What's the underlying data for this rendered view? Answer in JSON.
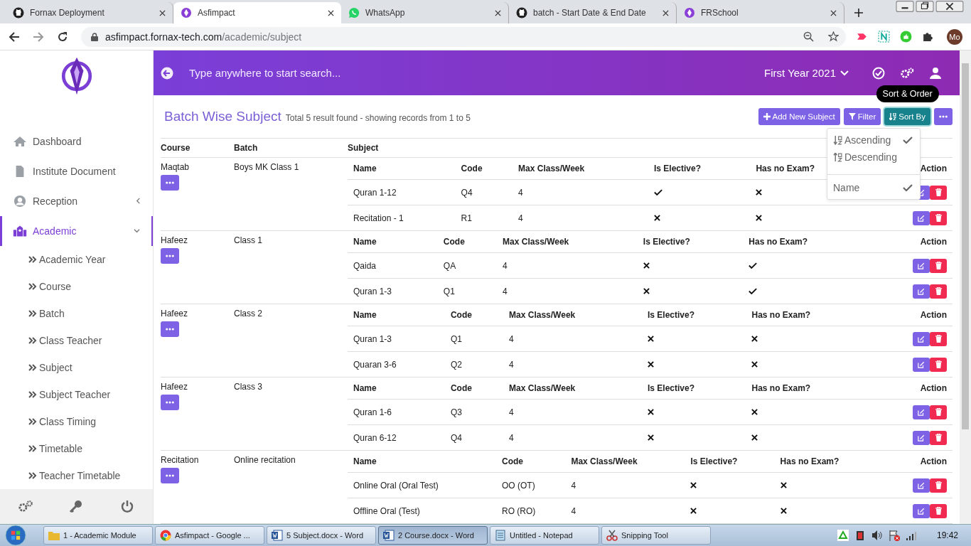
{
  "browser": {
    "tabs": [
      {
        "title": "Fornax Deployment",
        "kind": "github",
        "selected": false
      },
      {
        "title": "Asfimpact",
        "kind": "app",
        "selected": true
      },
      {
        "title": "WhatsApp",
        "kind": "whatsapp",
        "selected": false
      },
      {
        "title": "batch - Start Date & End Date",
        "kind": "github",
        "selected": false
      },
      {
        "title": "FRSchool",
        "kind": "app",
        "selected": false
      }
    ],
    "url": {
      "host": "asfimpact.fornax-tech.com",
      "path": "/academic/subject"
    },
    "profile": "Mo"
  },
  "header": {
    "search": {
      "placeholder": "Type anywhere to start search..."
    },
    "year": "First Year 2021"
  },
  "sidebar": {
    "items": [
      {
        "label": "Dashboard",
        "kind": "home"
      },
      {
        "label": "Institute Document",
        "kind": "document"
      },
      {
        "label": "Reception",
        "kind": "user",
        "expanded": false,
        "selected": false
      },
      {
        "label": "Academic",
        "kind": "school",
        "expanded": true,
        "selected": true,
        "children": [
          {
            "label": "Academic Year"
          },
          {
            "label": "Course"
          },
          {
            "label": "Batch"
          },
          {
            "label": "Class Teacher"
          },
          {
            "label": "Subject"
          },
          {
            "label": "Subject Teacher"
          },
          {
            "label": "Class Timing"
          },
          {
            "label": "Timetable"
          },
          {
            "label": "Teacher Timetable"
          }
        ]
      }
    ]
  },
  "page": {
    "title": "Batch Wise Subject",
    "summary": "Total 5 result found - showing records from 1 to 5",
    "buttons": [
      {
        "label": "Add New Subject",
        "kind": "add",
        "selected": false
      },
      {
        "label": "Filter",
        "kind": "filter",
        "selected": false
      },
      {
        "label": "Sort By",
        "kind": "sort",
        "selected": true
      },
      {
        "kind": "more",
        "selected": false
      }
    ],
    "tooltip": "Sort & Order",
    "sort_menu": [
      {
        "label": "Ascending",
        "kind": "ascending",
        "checked": true
      },
      {
        "label": "Descending",
        "kind": "descending",
        "checked": false
      },
      {
        "label": "Name",
        "kind": "field",
        "checked": true
      }
    ]
  },
  "table": {
    "columns": [
      "Course",
      "Batch",
      "Subject"
    ],
    "groups": [
      {
        "course": "Maqtab",
        "batch": "Boys MK Class 1",
        "subject_columns": [
          "Name",
          "Code",
          "Max Class/Week",
          "Is Elective?",
          "Has no Exam?",
          "Action"
        ],
        "subjects": [
          {
            "name": "Quran 1-12",
            "code": "Q4",
            "max": "4",
            "elective": true,
            "no_exam": false
          },
          {
            "name": "Recitation - 1",
            "code": "R1",
            "max": "4",
            "elective": false,
            "no_exam": false
          }
        ]
      },
      {
        "course": "Hafeez",
        "batch": "Class 1",
        "subject_columns": [
          "Name",
          "Code",
          "Max Class/Week",
          "Is Elective?",
          "Has no Exam?",
          "Action"
        ],
        "subjects": [
          {
            "name": "Qaida",
            "code": "QA",
            "max": "4",
            "elective": false,
            "no_exam": true
          },
          {
            "name": "Quran 1-3",
            "code": "Q1",
            "max": "4",
            "elective": false,
            "no_exam": true
          }
        ]
      },
      {
        "course": "Hafeez",
        "batch": "Class 2",
        "subject_columns": [
          "Name",
          "Code",
          "Max Class/Week",
          "Is Elective?",
          "Has no Exam?",
          "Action"
        ],
        "subjects": [
          {
            "name": "Quran 1-3",
            "code": "Q1",
            "max": "4",
            "elective": false,
            "no_exam": false
          },
          {
            "name": "Quaran 3-6",
            "code": "Q2",
            "max": "4",
            "elective": false,
            "no_exam": false
          }
        ]
      },
      {
        "course": "Hafeez",
        "batch": "Class 3",
        "subject_columns": [
          "Name",
          "Code",
          "Max Class/Week",
          "Is Elective?",
          "Has no Exam?",
          "Action"
        ],
        "subjects": [
          {
            "name": "Quran 1-6",
            "code": "Q3",
            "max": "4",
            "elective": false,
            "no_exam": false
          },
          {
            "name": "Quran 6-12",
            "code": "Q4",
            "max": "4",
            "elective": false,
            "no_exam": false
          }
        ]
      },
      {
        "course": "Recitation",
        "batch": "Online recitation",
        "subject_columns": [
          "Name",
          "Code",
          "Max Class/Week",
          "Is Elective?",
          "Has no Exam?",
          "Action"
        ],
        "subjects": [
          {
            "name": "Online Oral (Oral Test)",
            "code": "OO (OT)",
            "max": "4",
            "elective": false,
            "no_exam": false
          },
          {
            "name": "Offline Oral (Test)",
            "code": "RO (RO)",
            "max": "4",
            "elective": false,
            "no_exam": false
          }
        ]
      }
    ]
  },
  "taskbar": {
    "items": [
      {
        "label": "1 - Academic Module",
        "kind": "folder",
        "selected": false
      },
      {
        "label": "Asfimpact - Google ...",
        "kind": "chrome",
        "selected": false
      },
      {
        "label": "5 Subject.docx - Word",
        "kind": "word",
        "selected": false
      },
      {
        "label": "2 Course.docx - Word",
        "kind": "word",
        "selected": true
      },
      {
        "label": "Untitled - Notepad",
        "kind": "notepad",
        "selected": false
      },
      {
        "label": "Snipping Tool",
        "kind": "scissors",
        "selected": false
      }
    ],
    "clock": "19:42"
  }
}
